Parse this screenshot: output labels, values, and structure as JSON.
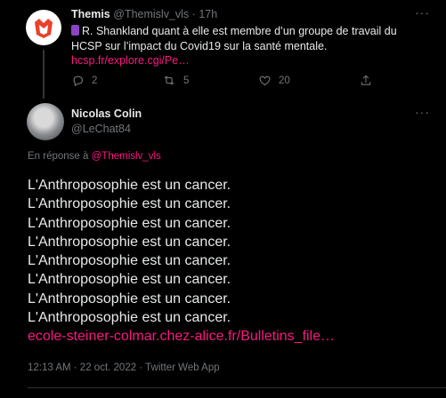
{
  "tweet1": {
    "author_name": "Themis",
    "author_handle": "@Themislv_vls",
    "separator": "·",
    "time": "17h",
    "more": "···",
    "text": "R. Shankland quant à elle est membre d’un groupe de travail du HCSP sur l’impact du Covid19 sur la santé mentale.",
    "link": "hcsp.fr/explore.cgi/Pe…",
    "replies": "2",
    "retweets": "5",
    "likes": "20"
  },
  "tweet2": {
    "author_name": "Nicolas Colin",
    "author_handle": "@LeChat84",
    "more": "···",
    "reply_prefix": "En réponse à",
    "reply_handle": "@Themislv_vls",
    "lines": [
      "L'Anthroposophie est un cancer.",
      "L'Anthroposophie est un cancer.",
      "L'Anthroposophie est un cancer.",
      "L'Anthroposophie est un cancer.",
      "L'Anthroposophie est un cancer.",
      "L'Anthroposophie est un cancer.",
      "L'Anthroposophie est un cancer.",
      "L'Anthroposophie est un cancer."
    ],
    "link": "ecole-steiner-colmar.chez-alice.fr/Bulletins_file…",
    "timestamp": "12:13 AM · 22 oct. 2022 · Twitter Web App"
  },
  "colors": {
    "background": "#000000",
    "text": "#e7e9ea",
    "muted": "#71767b",
    "accent": "#f91880"
  }
}
